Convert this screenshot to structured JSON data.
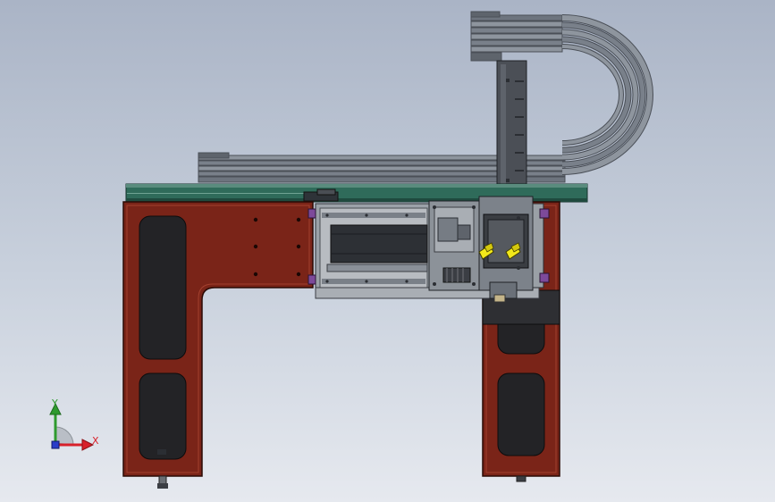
{
  "colors": {
    "background_top": "#aab4c6",
    "background_bottom": "#e6e9ef",
    "frame_body": "#7a2418",
    "frame_edge": "#3a0f08",
    "rail_green": "#2f6b5a",
    "steel_dark": "#4a4e54",
    "steel_mid": "#8a9098",
    "steel_light": "#c4c8cc",
    "cable": "#7d848e",
    "accent_yellow": "#f2e81a",
    "accent_purple": "#7d4a9a",
    "axis_x": "#d8202a",
    "axis_y": "#2e9a2e",
    "axis_z": "#2a3cc8"
  },
  "axis_triad": {
    "x_label": "X",
    "y_label": "Y"
  },
  "icons": {
    "triad": "coordinate-triad-icon"
  }
}
